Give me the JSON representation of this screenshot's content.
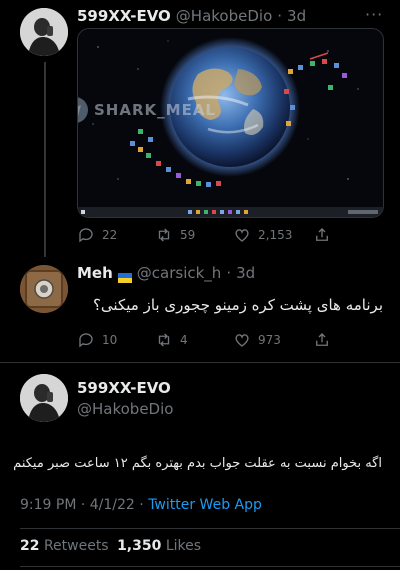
{
  "tweet1": {
    "display_name": "599XX-EVO",
    "handle": "@HakobeDio",
    "time": "3d",
    "media_watermark": "SHARK_MEAL",
    "actions": {
      "replies": "22",
      "retweets": "59",
      "likes": "2,153"
    }
  },
  "tweet2": {
    "display_name": "Meh",
    "flag": "🇺🇦",
    "handle": "@carsick_h",
    "time": "3d",
    "text": "برنامه های پشت کره زمینو چجوری باز میکنی؟",
    "actions": {
      "replies": "10",
      "retweets": "4",
      "likes": "973"
    }
  },
  "tweet3": {
    "display_name": "599XX-EVO",
    "handle": "@HakobeDio",
    "text": "اگه بخوام نسبت به عقلت جواب بدم بهتره بگم ۱۲ ساعت صبر میکنم",
    "timestamp": "9:19 PM · 4/1/22 · ",
    "source": "Twitter Web App",
    "retweets_count": "22",
    "retweets_label": "Retweets",
    "likes_count": "1,350",
    "likes_label": "Likes"
  },
  "colors": {
    "background": "#000000",
    "text": "#e7e9ea",
    "muted": "#71767b",
    "link": "#1d9bf0",
    "divider": "#2f3336"
  }
}
